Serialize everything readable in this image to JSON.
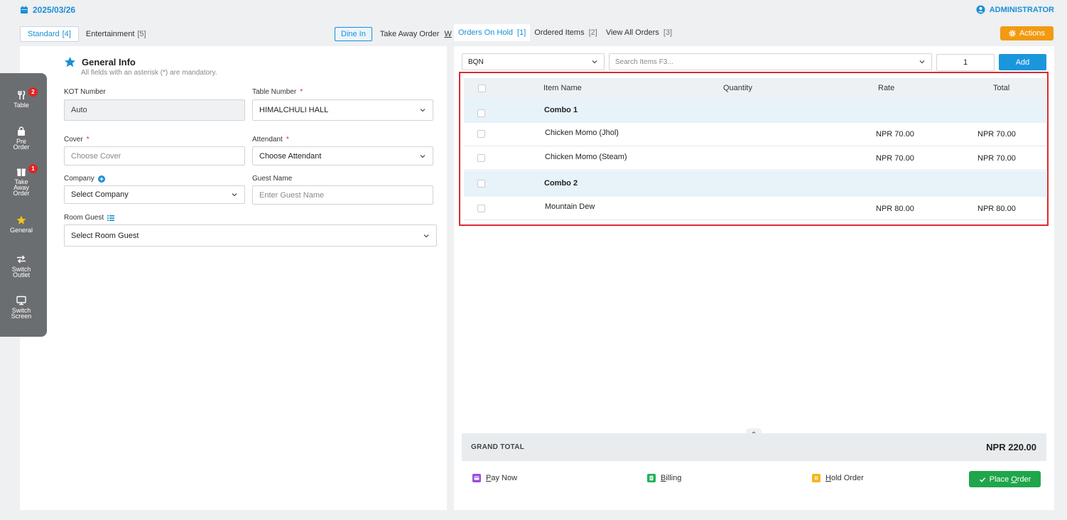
{
  "header": {
    "date": "2025/03/26",
    "user": "ADMINISTRATOR"
  },
  "order_type_tabs": [
    {
      "label": "Standard",
      "count": "[4]"
    },
    {
      "label": "Entertainment",
      "count": "[5]"
    }
  ],
  "dine_in": "Dine In",
  "take_away": {
    "prefix": "Take Away Order ",
    "key": "W"
  },
  "right_tabs": [
    {
      "label": "Orders On Hold",
      "count": "[1]"
    },
    {
      "label": "Ordered Items",
      "count": "[2]"
    },
    {
      "label": "View All Orders",
      "count": "[3]"
    }
  ],
  "actions_label": "Actions",
  "sidenav": [
    {
      "label_lines": [
        "Table"
      ],
      "badge": "2",
      "icon": "fork-knife-icon"
    },
    {
      "label_lines": [
        "Pre",
        "Order"
      ],
      "badge": "",
      "icon": "shopping-bag-icon"
    },
    {
      "label_lines": [
        "Take",
        "Away",
        "Order"
      ],
      "badge": "1",
      "icon": "package-icon"
    },
    {
      "label_lines": [
        "General"
      ],
      "badge": "",
      "icon": "star-icon"
    },
    {
      "label_lines": [
        "Switch",
        "Outlet"
      ],
      "badge": "",
      "icon": "arrows-swap-icon"
    },
    {
      "label_lines": [
        "Switch",
        "Screen"
      ],
      "badge": "",
      "icon": "monitor-icon"
    }
  ],
  "general_info": {
    "title": "General Info",
    "subtitle": "All fields with an asterisk (*) are mandatory.",
    "kot_label": "KOT Number",
    "kot_value": "Auto",
    "table_label": "Table Number",
    "table_value": "HIMALCHULI HALL",
    "cover_label": "Cover",
    "cover_placeholder": "Choose Cover",
    "attendant_label": "Attendant",
    "attendant_placeholder": "Choose Attendant",
    "company_label": "Company",
    "company_placeholder": "Select Company",
    "guest_label": "Guest Name",
    "guest_placeholder": "Enter Guest Name",
    "room_label": "Room Guest",
    "room_placeholder": "Select Room Guest",
    "asterisk": "*"
  },
  "order_entry": {
    "location": "BQN",
    "search_placeholder": "Search Items F3...",
    "quantity": "1",
    "add_label": "Add"
  },
  "table": {
    "headers": {
      "name": "Item Name",
      "quantity": "Quantity",
      "rate": "Rate",
      "total": "Total"
    },
    "rows": [
      {
        "type": "combo",
        "name": "Combo 1",
        "rate": "",
        "total": ""
      },
      {
        "type": "item",
        "name": "Chicken Momo (Jhol)",
        "rate": "NPR 70.00",
        "total": "NPR 70.00"
      },
      {
        "type": "item",
        "name": "Chicken Momo (Steam)",
        "rate": "NPR 70.00",
        "total": "NPR 70.00"
      },
      {
        "type": "combo",
        "name": "Combo 2",
        "rate": "",
        "total": ""
      },
      {
        "type": "item",
        "name": "Mountain Dew",
        "rate": "NPR 80.00",
        "total": "NPR 80.00"
      }
    ]
  },
  "grand_total": {
    "label": "GRAND TOTAL",
    "value": "NPR 220.00"
  },
  "footer": {
    "pay_now": {
      "key": "P",
      "rest": "ay Now"
    },
    "billing": {
      "key": "B",
      "rest": "illing"
    },
    "hold": {
      "key": "H",
      "rest": "old Order"
    },
    "place": {
      "prefix": "Place ",
      "key": "O",
      "rest": "rder"
    }
  },
  "colors": {
    "accent": "#1a8fd6",
    "warning": "#f29a11",
    "success": "#1fa64a",
    "danger": "#e02424",
    "highlight": "#e0282d"
  }
}
